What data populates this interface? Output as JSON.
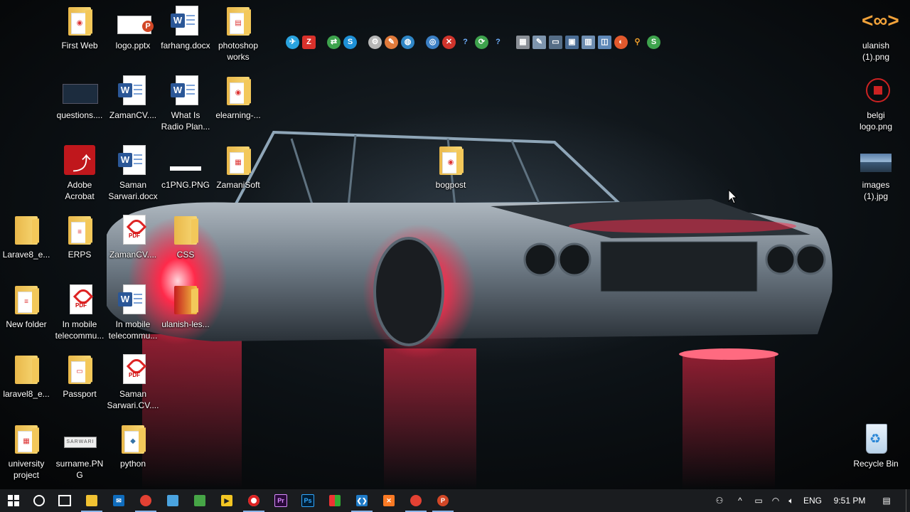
{
  "desktop": {
    "icons": [
      {
        "label": "First Web"
      },
      {
        "label": "logo.pptx"
      },
      {
        "label": "farhang.docx"
      },
      {
        "label": "photoshop works"
      },
      {
        "label": "questions...."
      },
      {
        "label": "ZamanCV...."
      },
      {
        "label": "What Is Radio Plan..."
      },
      {
        "label": "elearning-..."
      },
      {
        "label": "Adobe Acrobat"
      },
      {
        "label": "Saman Sarwari.docx"
      },
      {
        "label": "c1PNG.PNG"
      },
      {
        "label": "ZamaniSoft"
      },
      {
        "label": "bogpost"
      },
      {
        "label": "Larave8_e..."
      },
      {
        "label": "ERPS"
      },
      {
        "label": "ZamanCV...."
      },
      {
        "label": "CSS"
      },
      {
        "label": "New folder"
      },
      {
        "label": "In mobile telecommu..."
      },
      {
        "label": "In mobile telecommu..."
      },
      {
        "label": "ulanish-les..."
      },
      {
        "label": "laravel8_e..."
      },
      {
        "label": "Passport"
      },
      {
        "label": "Saman Sarwari.CV...."
      },
      {
        "label": "university project"
      },
      {
        "label": "surname.PNG"
      },
      {
        "label": "python"
      },
      {
        "label": "ulanish (1).png"
      },
      {
        "label": "belgi logo.png"
      },
      {
        "label": "images (1).jpg"
      },
      {
        "label": "Recycle Bin"
      }
    ],
    "plate_text": "SARWARI",
    "pdf_text": "PDF",
    "ppt_badge": "P",
    "word_badge": "W"
  },
  "taskbar": {
    "start_icon": "windows-logo-icon",
    "clock": "9:51 PM",
    "language": "ENG",
    "tray_chevron": "^"
  },
  "colors": {
    "taskbar": "#1a1c1f",
    "accent": "#8ab4e8",
    "wheel_glow": "#ff2a4a"
  }
}
